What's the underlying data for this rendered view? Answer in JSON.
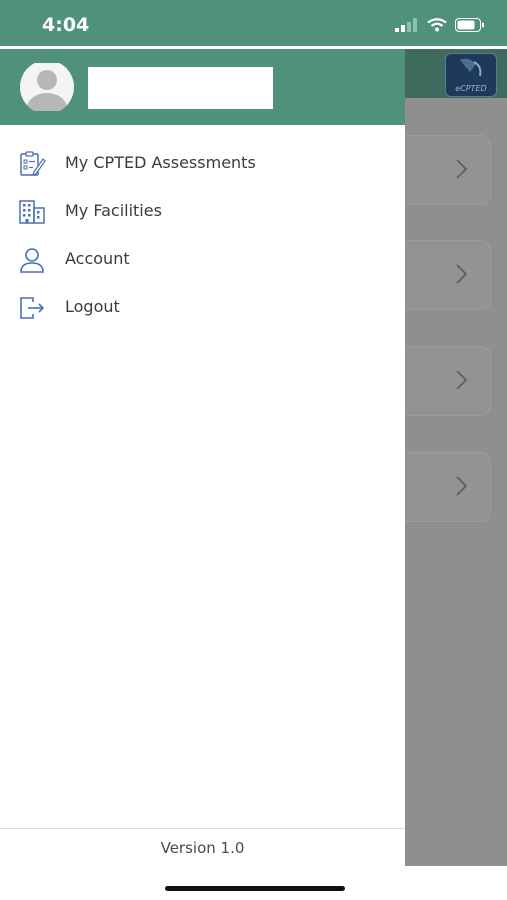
{
  "status_bar": {
    "time": "4:04",
    "icons": [
      "cellular-signal-icon",
      "wifi-icon",
      "battery-icon"
    ]
  },
  "drawer": {
    "header": {
      "avatar": "avatar-icon",
      "user_name": ""
    },
    "menu": [
      {
        "label": "My CPTED Assessments",
        "icon": "assessment-checklist-icon"
      },
      {
        "label": "My Facilities",
        "icon": "building-icon"
      },
      {
        "label": "Account",
        "icon": "person-icon"
      },
      {
        "label": "Logout",
        "icon": "logout-icon"
      }
    ],
    "footer": {
      "version": "Version 1.0"
    }
  },
  "background_app": {
    "logo_text": "eCPTED",
    "cards": [
      {
        "icon": "chevron-right-icon"
      },
      {
        "icon": "chevron-right-icon"
      },
      {
        "icon": "chevron-right-icon"
      },
      {
        "icon": "chevron-right-icon"
      }
    ]
  },
  "colors": {
    "header_green": "#4f917a",
    "dim_overlay": "#8f8f8f",
    "icon_blue": "#4a6fb5",
    "text": "#3b3b3b"
  }
}
